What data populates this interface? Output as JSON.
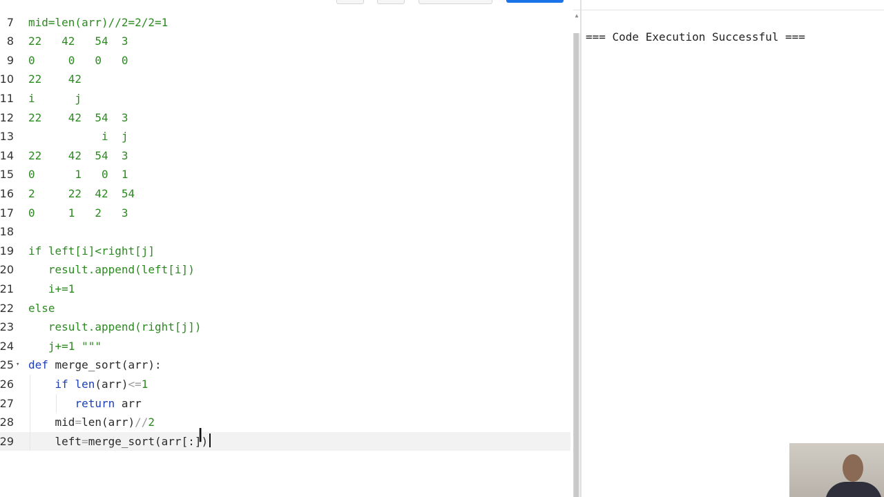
{
  "editor": {
    "lines": [
      {
        "num": "7",
        "segments": [
          {
            "t": "mid=len(arr)//2=2/2=1",
            "c": "str"
          }
        ]
      },
      {
        "num": "8",
        "segments": [
          {
            "t": "22   42   54  3",
            "c": "str"
          }
        ]
      },
      {
        "num": "9",
        "segments": [
          {
            "t": "0     0   0   0",
            "c": "str"
          }
        ]
      },
      {
        "num": "10",
        "segments": [
          {
            "t": "22    42",
            "c": "str"
          }
        ]
      },
      {
        "num": "11",
        "segments": [
          {
            "t": "i      j",
            "c": "str"
          }
        ]
      },
      {
        "num": "12",
        "segments": [
          {
            "t": "22    42  54  3",
            "c": "str"
          }
        ]
      },
      {
        "num": "13",
        "segments": [
          {
            "t": "           i  j",
            "c": "str"
          }
        ]
      },
      {
        "num": "14",
        "segments": [
          {
            "t": "22    42  54  3",
            "c": "str"
          }
        ]
      },
      {
        "num": "15",
        "segments": [
          {
            "t": "0      1   0  1",
            "c": "str"
          }
        ]
      },
      {
        "num": "16",
        "segments": [
          {
            "t": "2     22  42  54",
            "c": "str"
          }
        ]
      },
      {
        "num": "17",
        "segments": [
          {
            "t": "0     1   2   3",
            "c": "str"
          }
        ]
      },
      {
        "num": "18",
        "segments": []
      },
      {
        "num": "19",
        "segments": [
          {
            "t": "if left[i]<right[j]",
            "c": "str"
          }
        ]
      },
      {
        "num": "20",
        "segments": [
          {
            "t": "   result.append(left[i])",
            "c": "str"
          }
        ]
      },
      {
        "num": "21",
        "segments": [
          {
            "t": "   i+=1",
            "c": "str"
          }
        ]
      },
      {
        "num": "22",
        "segments": [
          {
            "t": "else",
            "c": "str"
          }
        ]
      },
      {
        "num": "23",
        "segments": [
          {
            "t": "   result.append(right[j])",
            "c": "str"
          }
        ]
      },
      {
        "num": "24",
        "segments": [
          {
            "t": "   j+=1 \"\"\"",
            "c": "str"
          }
        ]
      },
      {
        "num": "25",
        "fold": "▾",
        "segments": [
          {
            "t": "def",
            "c": "kw"
          },
          {
            "t": " merge_sort(arr):",
            "c": "plain"
          }
        ]
      },
      {
        "num": "26",
        "segments": [
          {
            "t": "    ",
            "c": "plain"
          },
          {
            "t": "if",
            "c": "kw"
          },
          {
            "t": " ",
            "c": "plain"
          },
          {
            "t": "len",
            "c": "call"
          },
          {
            "t": "(arr)",
            "c": "plain"
          },
          {
            "t": "<=",
            "c": "op"
          },
          {
            "t": "1",
            "c": "num"
          }
        ]
      },
      {
        "num": "27",
        "segments": [
          {
            "t": "       ",
            "c": "plain"
          },
          {
            "t": "return",
            "c": "kw"
          },
          {
            "t": " arr",
            "c": "plain"
          }
        ]
      },
      {
        "num": "28",
        "segments": [
          {
            "t": "    mid",
            "c": "plain"
          },
          {
            "t": "=",
            "c": "op"
          },
          {
            "t": "len(arr)",
            "c": "plain"
          },
          {
            "t": "//",
            "c": "op"
          },
          {
            "t": "2",
            "c": "num"
          }
        ]
      },
      {
        "num": "29",
        "active": true,
        "segments": [
          {
            "t": "    left",
            "c": "plain"
          },
          {
            "t": "=",
            "c": "op"
          },
          {
            "t": "merge_sort(arr[:])",
            "c": "plain"
          }
        ]
      }
    ]
  },
  "output": {
    "text": "=== Code Execution Successful ==="
  }
}
